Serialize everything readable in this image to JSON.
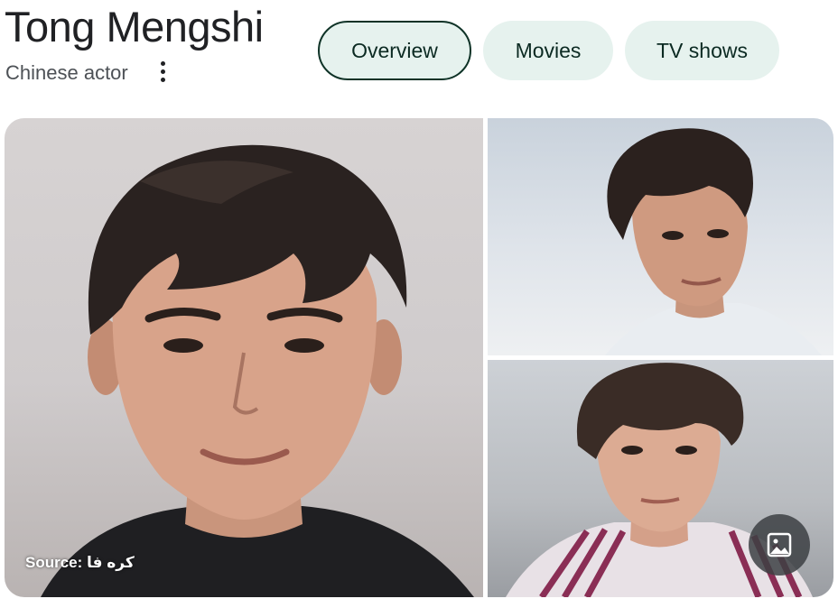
{
  "header": {
    "title": "Tong Mengshi",
    "subtitle": "Chinese actor"
  },
  "tabs": [
    {
      "label": "Overview",
      "active": true
    },
    {
      "label": "Movies",
      "active": false
    },
    {
      "label": "TV shows",
      "active": false
    }
  ],
  "gallery": {
    "source_prefix": "Source:",
    "source_name": "کره فا"
  },
  "icons": {
    "more": "more-vert-icon",
    "images": "image-icon"
  },
  "colors": {
    "tab_bg": "#e6f2ee",
    "tab_active_border": "#0f3327",
    "title": "#202124"
  }
}
